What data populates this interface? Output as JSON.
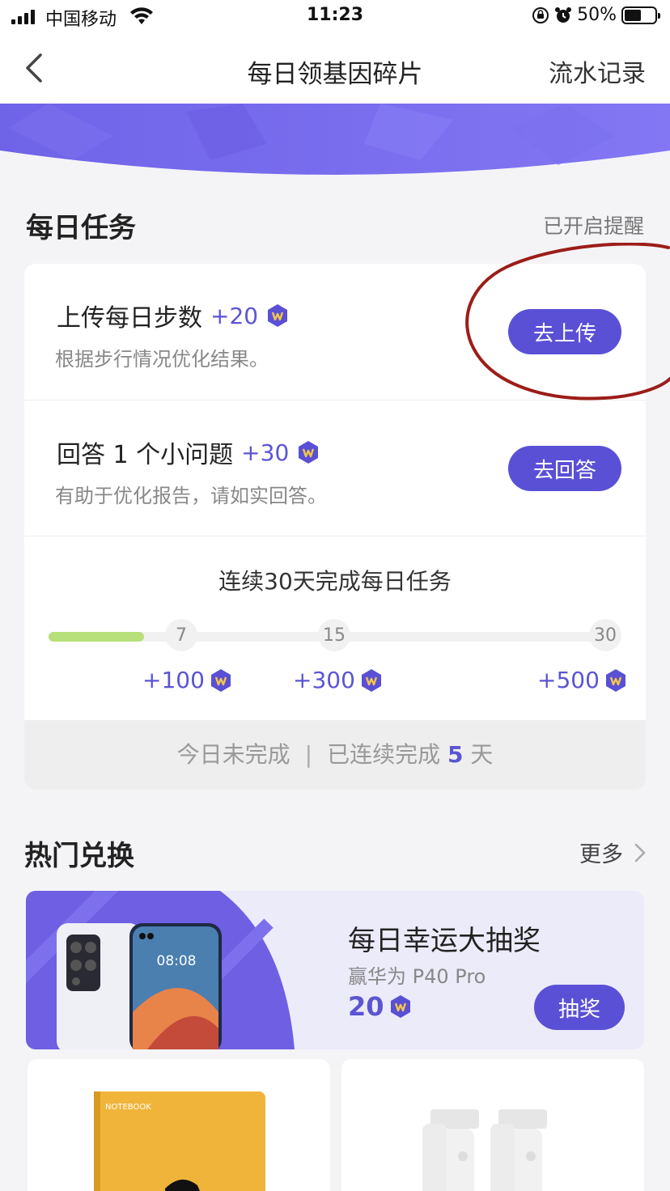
{
  "status_bar": {
    "carrier": "中国移动",
    "time": "11:23",
    "battery": "50%"
  },
  "nav": {
    "title": "每日领基因碎片",
    "right_link": "流水记录"
  },
  "daily": {
    "section_title": "每日任务",
    "reminder_status": "已开启提醒",
    "tasks": [
      {
        "title": "上传每日步数",
        "reward": "+20",
        "desc": "根据步行情况优化结果。",
        "button": "去上传"
      },
      {
        "title": "回答 1 个小问题",
        "reward": "+30",
        "desc": "有助于优化报告，请如实回答。",
        "button": "去回答"
      }
    ],
    "streak": {
      "title": "连续30天完成每日任务",
      "progress_days": 5,
      "total_days": 30,
      "milestones": [
        {
          "day": "7",
          "reward": "+100"
        },
        {
          "day": "15",
          "reward": "+300"
        },
        {
          "day": "30",
          "reward": "+500"
        }
      ],
      "status_today": "今日未完成",
      "separator": "|",
      "completed_prefix": "已连续完成",
      "completed_days": "5",
      "completed_suffix": "天"
    }
  },
  "hot": {
    "section_title": "热门兑换",
    "more_label": "更多",
    "lottery": {
      "title": "每日幸运大抽奖",
      "subtitle": "赢华为 P40 Pro",
      "price": "20",
      "button": "抽奖",
      "phone_time": "08:08"
    },
    "products": [
      {
        "cover_text": "NOTEBOOK"
      }
    ]
  },
  "colors": {
    "accent": "#5a50d6",
    "progress": "#b8e07a",
    "banner": "#7a6ef0"
  }
}
